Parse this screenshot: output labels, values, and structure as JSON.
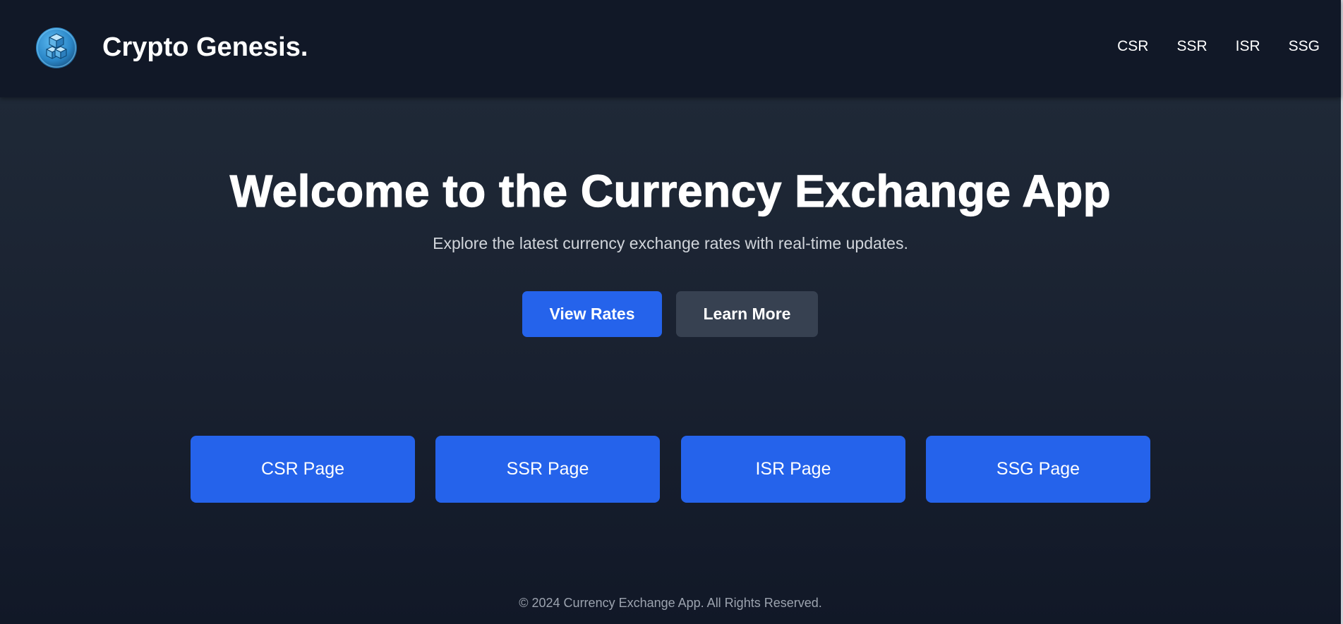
{
  "header": {
    "brand": "Crypto Genesis.",
    "logo_icon": "cube-logo-icon",
    "nav": [
      "CSR",
      "SSR",
      "ISR",
      "SSG"
    ]
  },
  "hero": {
    "title": "Welcome to the Currency Exchange App",
    "subtitle": "Explore the latest currency exchange rates with real-time updates.",
    "primary_button": "View Rates",
    "secondary_button": "Learn More"
  },
  "cards": [
    "CSR Page",
    "SSR Page",
    "ISR Page",
    "SSG Page"
  ],
  "footer": {
    "text": "© 2024 Currency Exchange App. All Rights Reserved."
  },
  "colors": {
    "background": "#111827",
    "accent": "#2563eb",
    "secondary": "#374151"
  }
}
